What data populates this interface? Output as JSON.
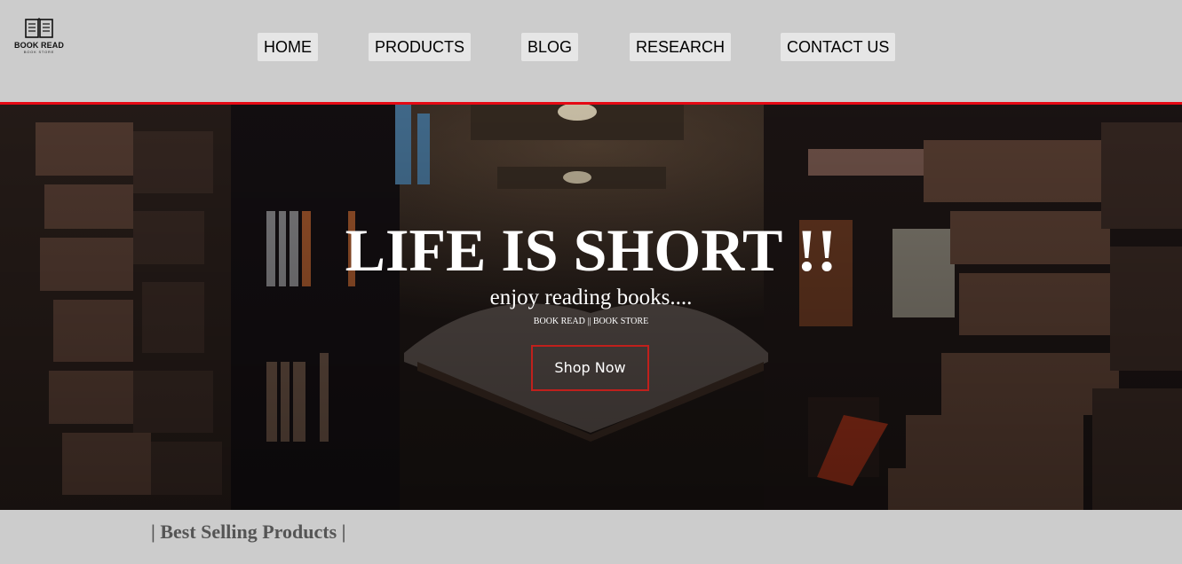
{
  "logo": {
    "title": "BOOK READ",
    "subtitle": "BOOK STORE",
    "icon": "open-book-icon"
  },
  "nav": {
    "items": [
      {
        "label": "HOME"
      },
      {
        "label": "PRODUCTS"
      },
      {
        "label": "BLOG"
      },
      {
        "label": "RESEARCH"
      },
      {
        "label": "CONTACT US"
      }
    ]
  },
  "hero": {
    "title": "LIFE IS SHORT !!",
    "subtitle": "enjoy reading books....",
    "tagline": "BOOK READ || BOOK STORE",
    "cta_label": "Shop Now"
  },
  "section": {
    "title": "| Best Selling Products |"
  },
  "colors": {
    "header_bg": "#cccccc",
    "accent_red": "#e50914",
    "nav_button_bg": "#e6e6e6",
    "hero_text": "#ffffff",
    "section_title": "#555555"
  }
}
